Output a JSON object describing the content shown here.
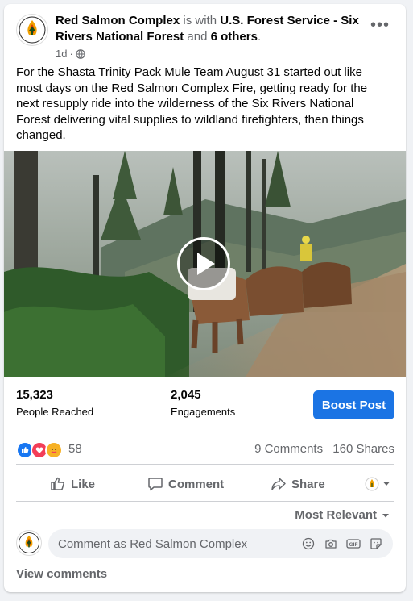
{
  "post": {
    "page_name": "Red Salmon Complex",
    "is_with": "is with",
    "tagged": "U.S. Forest Service - Six Rivers National Forest",
    "and_text": "and",
    "others": "6 others",
    "period": ".",
    "time": "1d",
    "dot": "·",
    "more_label": "•••",
    "avatar_text": "F.I.R.E",
    "body": "For the Shasta Trinity Pack Mule Team August 31 started out like most days on the Red Salmon Complex Fire, getting ready for the next resupply ride into the wilderness of the Six Rivers National Forest delivering vital supplies to wildland firefighters, then things changed."
  },
  "stats": {
    "reached_value": "15,323",
    "reached_label": "People Reached",
    "engagements_value": "2,045",
    "engagements_label": "Engagements",
    "boost_label": "Boost Post"
  },
  "reactions": {
    "count": "58",
    "comments": "9 Comments",
    "shares": "160 Shares"
  },
  "actions": {
    "like": "Like",
    "comment": "Comment",
    "share": "Share"
  },
  "comments": {
    "sort_label": "Most Relevant",
    "placeholder": "Comment as Red Salmon Complex",
    "view_label": "View comments"
  },
  "colors": {
    "accent": "#1b74e4",
    "muted": "#65676b",
    "like_blue": "#1877f2",
    "love_red": "#f33e58",
    "care_yellow": "#f7b125"
  }
}
